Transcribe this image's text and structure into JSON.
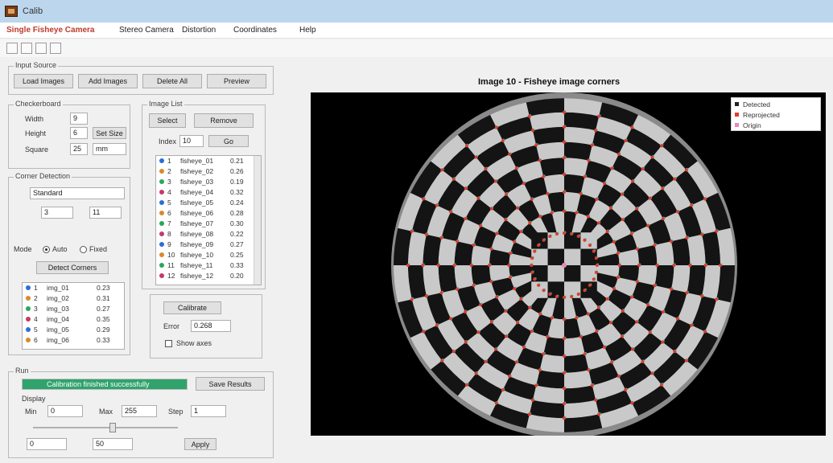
{
  "window": {
    "title": "Calib"
  },
  "menu": [
    {
      "label": "Single Fisheye Camera",
      "active": true
    },
    {
      "label": "Stereo Camera",
      "active": false
    },
    {
      "label": "Distortion",
      "active": false
    },
    {
      "label": "Coordinates",
      "active": false
    },
    {
      "label": "Help",
      "active": false
    }
  ],
  "toolbar_icons": [
    "open-icon",
    "save-icon",
    "export-icon",
    "settings-icon"
  ],
  "top_group": {
    "label": "Input Source",
    "buttons": [
      "Load Images",
      "Add Images",
      "Delete All",
      "Preview"
    ]
  },
  "board_group": {
    "label": "Checkerboard",
    "width_label": "Width",
    "width_value": "9",
    "height_label": "Height",
    "height_value": "6",
    "square_label": "Square",
    "square_value": "25",
    "size_btn": "Set Size",
    "unit_value": "mm"
  },
  "detect_group": {
    "label": "Corner Detection",
    "select_value": "Standard",
    "min_value": "3",
    "max_value": "11",
    "mode_label": "Mode",
    "mode_opt1": "Auto",
    "mode_opt2": "Fixed",
    "detect_btn": "Detect Corners",
    "rows": [
      {
        "id": "1",
        "name": "img_01",
        "val": "0.23"
      },
      {
        "id": "2",
        "name": "img_02",
        "val": "0.31"
      },
      {
        "id": "3",
        "name": "img_03",
        "val": "0.27"
      },
      {
        "id": "4",
        "name": "img_04",
        "val": "0.35"
      },
      {
        "id": "5",
        "name": "img_05",
        "val": "0.29"
      },
      {
        "id": "6",
        "name": "img_06",
        "val": "0.33"
      }
    ]
  },
  "images_group": {
    "label": "Image List",
    "btn_left": "Select",
    "btn_right": "Remove",
    "index_label": "Index",
    "index_value": "10",
    "jump_btn": "Go",
    "rows": [
      {
        "id": "1",
        "name": "fisheye_01",
        "val": "0.21"
      },
      {
        "id": "2",
        "name": "fisheye_02",
        "val": "0.26"
      },
      {
        "id": "3",
        "name": "fisheye_03",
        "val": "0.19"
      },
      {
        "id": "4",
        "name": "fisheye_04",
        "val": "0.32"
      },
      {
        "id": "5",
        "name": "fisheye_05",
        "val": "0.24"
      },
      {
        "id": "6",
        "name": "fisheye_06",
        "val": "0.28"
      },
      {
        "id": "7",
        "name": "fisheye_07",
        "val": "0.30"
      },
      {
        "id": "8",
        "name": "fisheye_08",
        "val": "0.22"
      },
      {
        "id": "9",
        "name": "fisheye_09",
        "val": "0.27"
      },
      {
        "id": "10",
        "name": "fisheye_10",
        "val": "0.25"
      },
      {
        "id": "11",
        "name": "fisheye_11",
        "val": "0.33"
      },
      {
        "id": "12",
        "name": "fisheye_12",
        "val": "0.20"
      }
    ]
  },
  "calib_group": {
    "btn": "Calibrate",
    "error_label": "Error",
    "error_value": "0.268",
    "check_label": "Show axes"
  },
  "run_group": {
    "label": "Run",
    "progress": 1.0,
    "progress_text": "Calibration finished successfully",
    "side_btn": "Save Results",
    "sub_label": "Display",
    "field1_label": "Min",
    "field1_value": "0",
    "field2_label": "Max",
    "field2_value": "255",
    "field3_label": "Step",
    "field3_value": "1",
    "slider_min": "0",
    "slider_mid": "50",
    "slider_value": 0.55,
    "slider_btn": "Apply"
  },
  "plot": {
    "title": "Image 10 - Fisheye image corners",
    "legend": [
      {
        "label": "Detected",
        "color": "#222222"
      },
      {
        "label": "Reprojected",
        "color": "#e23b2a"
      },
      {
        "label": "Origin",
        "color": "#e889b8"
      }
    ],
    "board_light": "#c9c9c9",
    "board_dark": "#141414",
    "corner_color": "#e23b2a",
    "detected_color": "#21d0c0"
  }
}
